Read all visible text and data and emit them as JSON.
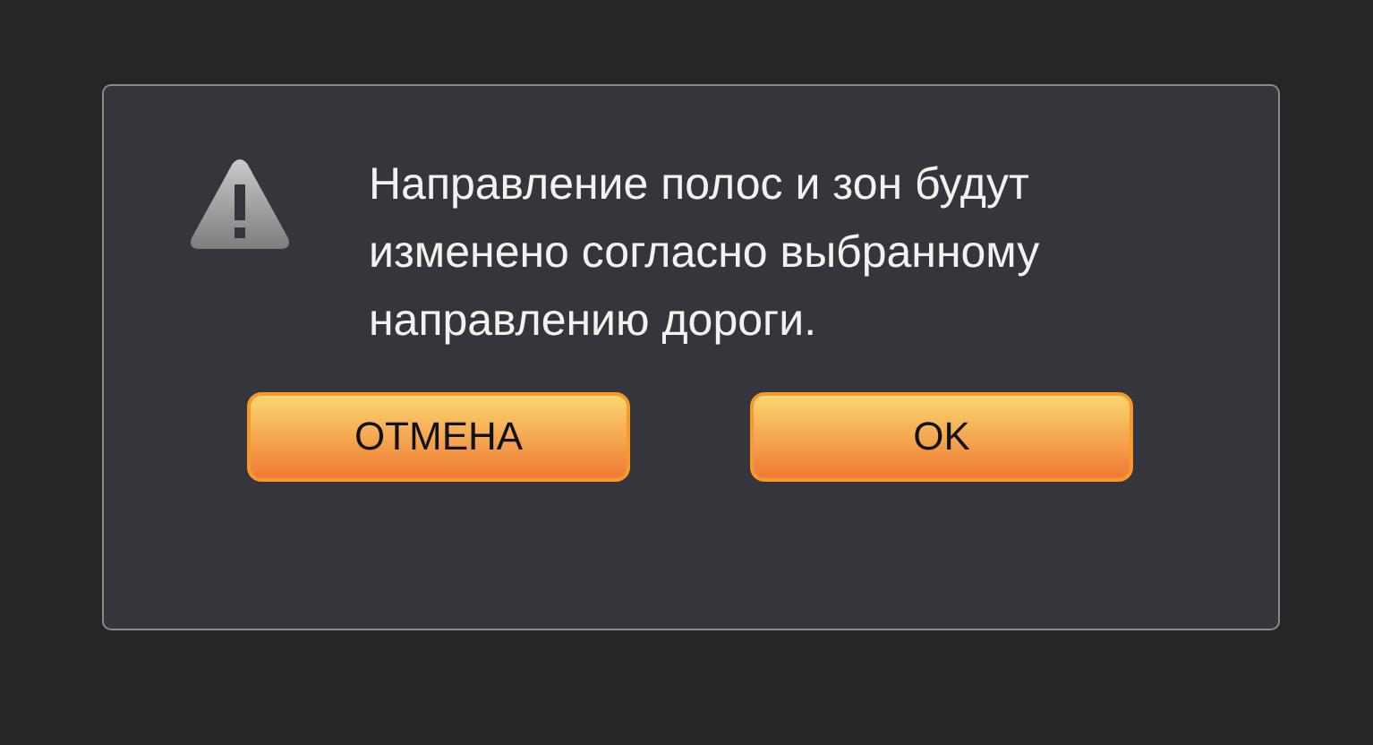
{
  "dialog": {
    "message": "Направление полос и зон будут изменено согласно выбранному направлению дороги.",
    "buttons": [
      {
        "label": "ОТМЕНА"
      },
      {
        "label": "OK"
      }
    ]
  }
}
